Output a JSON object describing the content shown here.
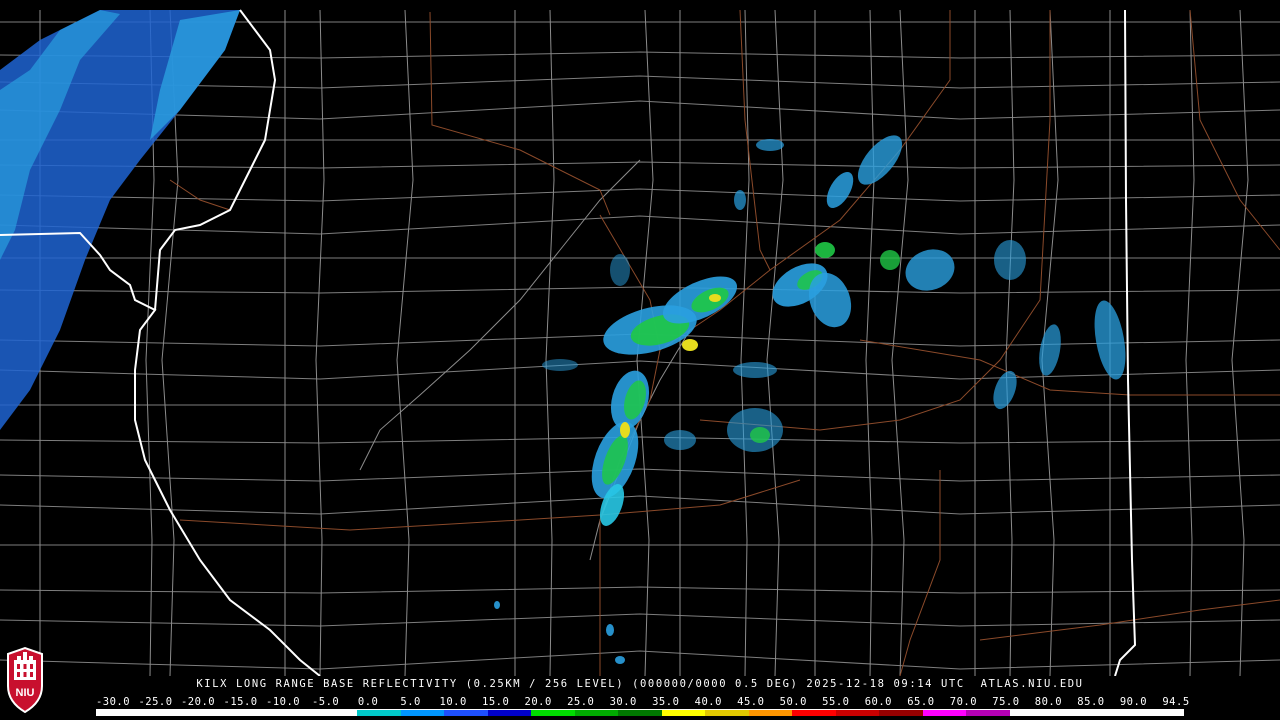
{
  "product": {
    "caption": "KILX LONG RANGE BASE REFLECTIVITY (0.25KM / 256 LEVEL) (000000/0000 0.5 DEG) 2025-12-18 09:14 UTC  ATLAS.NIU.EDU"
  },
  "logo": {
    "text": "NIU",
    "color": "#c8102e"
  },
  "legend": {
    "labels": [
      "-30.0",
      "-25.0",
      "-20.0",
      "-15.0",
      "-10.0",
      "-5.0",
      "0.0",
      "5.0",
      "10.0",
      "15.0",
      "20.0",
      "25.0",
      "30.0",
      "35.0",
      "40.0",
      "45.0",
      "50.0",
      "55.0",
      "60.0",
      "65.0",
      "70.0",
      "75.0",
      "80.0",
      "85.0",
      "90.0",
      "94.5"
    ],
    "colors": [
      "#ffffff",
      "#ffffff",
      "#ffffff",
      "#ffffff",
      "#ffffff",
      "#ffffff",
      "#00c8c8",
      "#0096ff",
      "#1e50ff",
      "#0000c8",
      "#00dc00",
      "#00aa00",
      "#007800",
      "#ffff00",
      "#e1c800",
      "#ff9600",
      "#ff0000",
      "#c80000",
      "#960000",
      "#ff00ff",
      "#b400b4",
      "#ffffff",
      "#ffffff",
      "#ffffff",
      "#ffffff"
    ]
  },
  "map_colors": {
    "county": "#8c8c8c",
    "state": "#ffffff",
    "road": "#8b4a2a",
    "echo_light": "#2aa0e0",
    "echo_mid": "#1e64d2",
    "echo_cyan": "#28c8e6",
    "echo_green": "#1fc846",
    "echo_yellow": "#e6dc1e"
  }
}
